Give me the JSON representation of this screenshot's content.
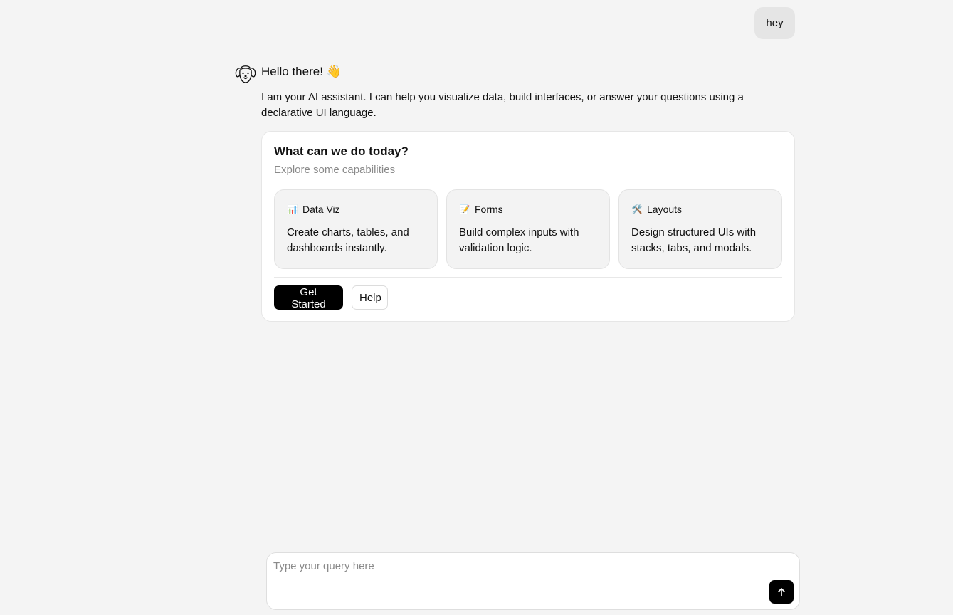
{
  "chat": {
    "user_message": "hey",
    "assistant": {
      "greeting": "Hello there! 👋",
      "intro": "I am your AI assistant. I can help you visualize data, build interfaces, or answer your questions using a declarative UI language."
    }
  },
  "card": {
    "title": "What can we do today?",
    "subtitle": "Explore some capabilities",
    "features": [
      {
        "icon": "📊",
        "icon_name": "bar-chart-icon",
        "label": "Data Viz",
        "description": "Create charts, tables, and dashboards instantly."
      },
      {
        "icon": "📝",
        "icon_name": "memo-icon",
        "label": "Forms",
        "description": "Build complex inputs with validation logic."
      },
      {
        "icon": "🛠️",
        "icon_name": "tools-icon",
        "label": "Layouts",
        "description": "Design structured UIs with stacks, tabs, and modals."
      }
    ],
    "primary_button": "Get Started",
    "secondary_button": "Help"
  },
  "composer": {
    "placeholder": "Type your query here",
    "value": ""
  },
  "colors": {
    "background": "#f4f4f4",
    "primary": "#000000",
    "user_bubble": "#e5e5e5",
    "feature_card": "#f3f3f3",
    "muted_text": "#8a8a8a"
  }
}
